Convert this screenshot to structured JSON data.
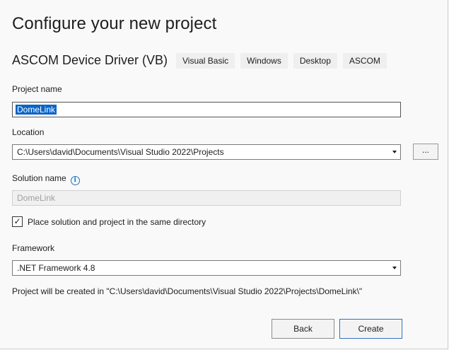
{
  "header": {
    "title": "Configure your new project",
    "template_name": "ASCOM Device Driver (VB)",
    "tags": [
      "Visual Basic",
      "Windows",
      "Desktop",
      "ASCOM"
    ]
  },
  "project_name": {
    "label": "Project name",
    "value": "DomeLink"
  },
  "location": {
    "label": "Location",
    "value": "C:\\Users\\david\\Documents\\Visual Studio 2022\\Projects",
    "browse_label": "..."
  },
  "solution_name": {
    "label": "Solution name",
    "placeholder": "DomeLink"
  },
  "same_directory": {
    "label": "Place solution and project in the same directory",
    "checked": true,
    "check_glyph": "✓"
  },
  "framework": {
    "label": "Framework",
    "value": ".NET Framework 4.8"
  },
  "path_note": "Project will be created in \"C:\\Users\\david\\Documents\\Visual Studio 2022\\Projects\\DomeLink\\\"",
  "buttons": {
    "back": "Back",
    "create": "Create"
  },
  "icons": {
    "info": "i"
  },
  "colors": {
    "accent": "#0a64c8",
    "info": "#1b75c5"
  }
}
